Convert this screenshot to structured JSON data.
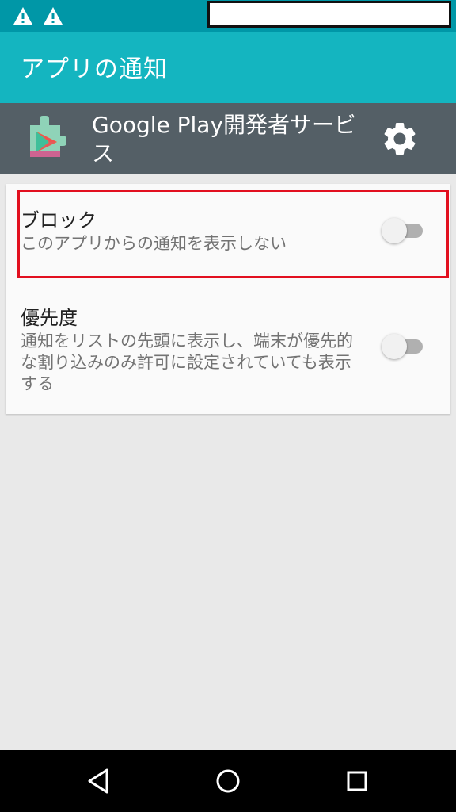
{
  "status_bar": {
    "icons": [
      "warning-icon",
      "warning-icon"
    ]
  },
  "app_bar": {
    "title": "アプリの通知"
  },
  "app_header": {
    "icon": "google-play-services-icon",
    "name": "Google Play開発者サービス",
    "settings_icon": "gear-icon"
  },
  "settings": [
    {
      "title": "ブロック",
      "subtitle": "このアプリからの通知を表示しない",
      "enabled": false
    },
    {
      "title": "優先度",
      "subtitle": "通知をリストの先頭に表示し、端末が優先的な割り込みのみ許可に設定されていても表示する",
      "enabled": false
    }
  ],
  "nav_bar": {
    "buttons": [
      "back-icon",
      "home-icon",
      "recents-icon"
    ]
  },
  "colors": {
    "status_bar": "#0097a7",
    "app_bar": "#14b5c0",
    "app_header": "#545f66",
    "highlight": "#e2101f"
  }
}
